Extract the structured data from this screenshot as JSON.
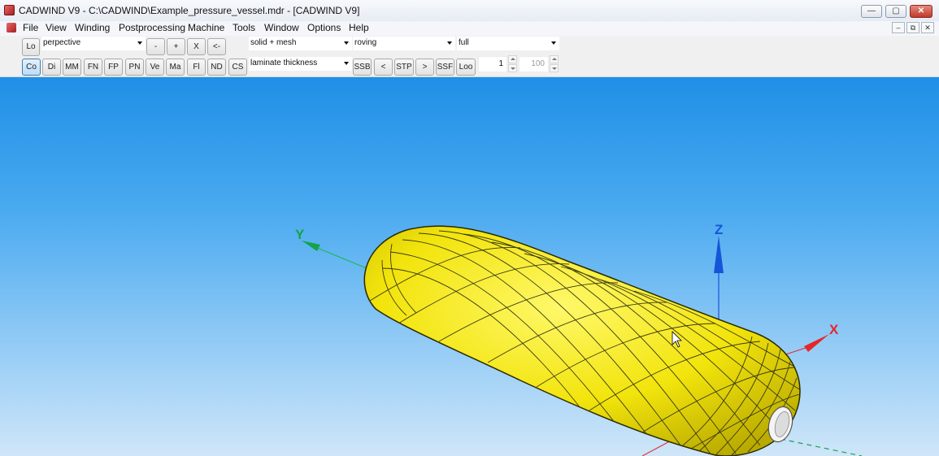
{
  "window": {
    "title": "CADWIND V9  -  C:\\CADWIND\\Example_pressure_vessel.mdr - [CADWIND V9]",
    "controls": [
      "—",
      "▢",
      "✕"
    ]
  },
  "menu": {
    "items": [
      "File",
      "View",
      "Winding",
      "Postprocessing",
      "Machine",
      "Tools",
      "Window",
      "Options",
      "Help"
    ],
    "mdi_controls": [
      "–",
      "⧉",
      "✕"
    ]
  },
  "toolbar": {
    "lo_label": "Lo",
    "projection": {
      "value": "perpective"
    },
    "view_buttons": [
      "-",
      "+",
      "X",
      "<-"
    ],
    "render_mode": {
      "value": "solid + mesh"
    },
    "material": {
      "value": "roving"
    },
    "extent": {
      "value": "full"
    },
    "toggle_buttons": [
      "Co",
      "Di",
      "MM",
      "FN",
      "FP",
      "PN",
      "Ve",
      "Ma",
      "Fl",
      "ND",
      "CS"
    ],
    "active_toggle": "Co",
    "display_mode": {
      "value": "laminate thickness"
    },
    "step_buttons": [
      "SSB",
      "<",
      "STP",
      ">",
      "SSF",
      "Loo"
    ],
    "current_layer": "1",
    "max_layer": "100"
  },
  "viewport": {
    "background_top": "#1f8fe6",
    "background_bottom": "#cfe6f8",
    "vessel_color": "#f2e40c",
    "axes": {
      "x_label": "X",
      "x_color": "#e42828",
      "y_label": "Y",
      "y_color": "#16a34a",
      "z_label": "Z",
      "z_color": "#1655d8"
    }
  }
}
